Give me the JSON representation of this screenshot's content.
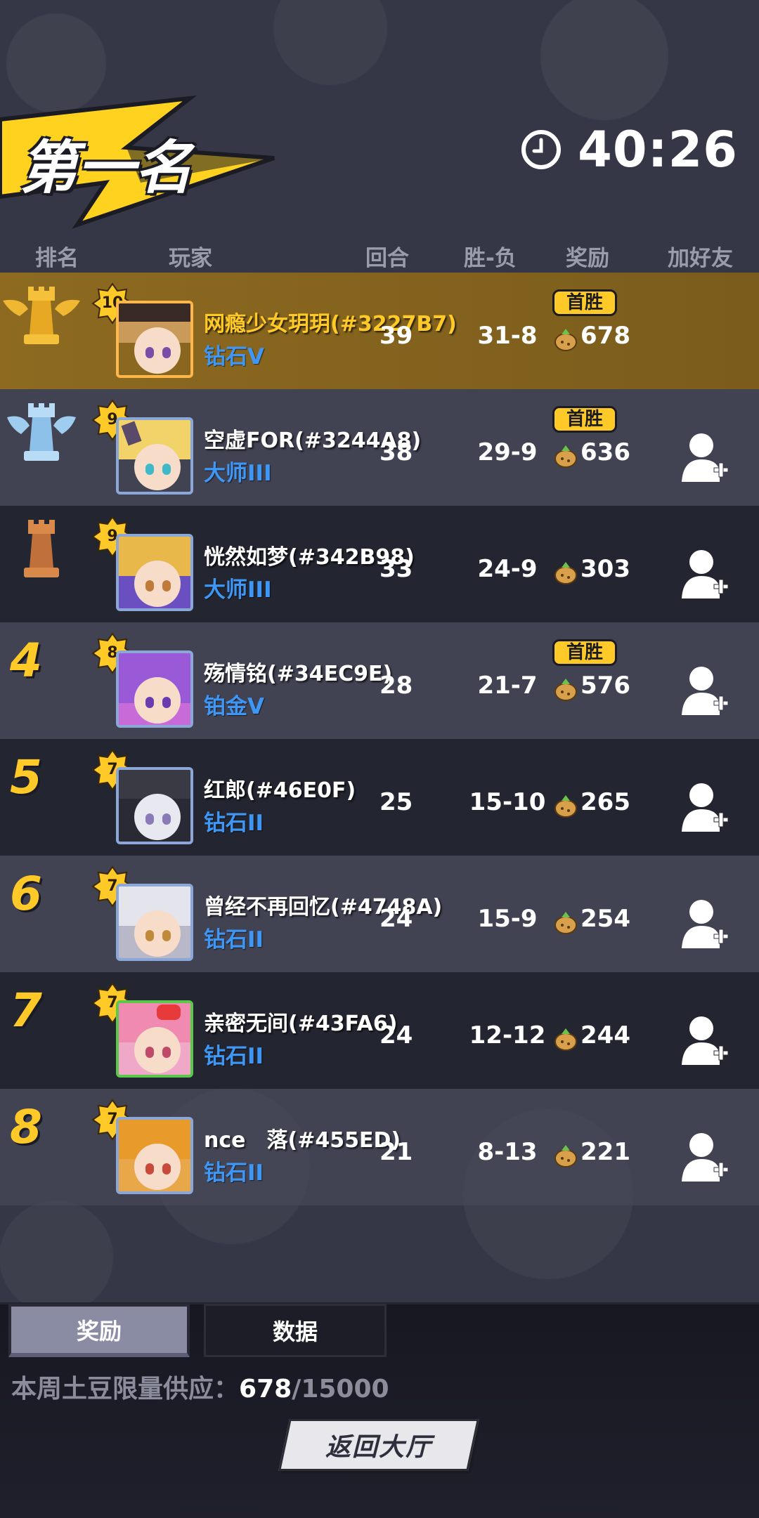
{
  "header": {
    "rank_title": "第一名",
    "timer": "40:26"
  },
  "columns": {
    "rank": "排名",
    "player": "玩家",
    "rounds": "回合",
    "win_loss": "胜-负",
    "reward": "奖励",
    "add_friend": "加好友"
  },
  "first_win_label": "首胜",
  "players": [
    {
      "rank": "1",
      "level": "10",
      "name": "网瘾少女玥玥(#3227B7)",
      "tier": "钻石V",
      "rounds": "39",
      "wl": "31-8",
      "reward": "678"
    },
    {
      "rank": "2",
      "level": "9",
      "name": "空虚FOR(#3244A8)",
      "tier": "大师III",
      "rounds": "38",
      "wl": "29-9",
      "reward": "636"
    },
    {
      "rank": "3",
      "level": "9",
      "name": "恍然如梦(#342B98)",
      "tier": "大师III",
      "rounds": "33",
      "wl": "24-9",
      "reward": "303"
    },
    {
      "rank": "4",
      "level": "8",
      "name": "殇情铭(#34EC9E)",
      "tier": "铂金V",
      "rounds": "28",
      "wl": "21-7",
      "reward": "576"
    },
    {
      "rank": "5",
      "level": "7",
      "name": "红郎(#46E0F)",
      "tier": "钻石II",
      "rounds": "25",
      "wl": "15-10",
      "reward": "265"
    },
    {
      "rank": "6",
      "level": "7",
      "name": "曾经不再回忆(#4748A)",
      "tier": "钻石II",
      "rounds": "24",
      "wl": "15-9",
      "reward": "254"
    },
    {
      "rank": "7",
      "level": "7",
      "name": "亲密无间(#43FA6)",
      "tier": "钻石II",
      "rounds": "24",
      "wl": "12-12",
      "reward": "244"
    },
    {
      "rank": "8",
      "level": "7",
      "name": "nce　落(#455ED)",
      "tier": "钻石II",
      "rounds": "21",
      "wl": "8-13",
      "reward": "221"
    }
  ],
  "tabs": {
    "rewards": "奖励",
    "data": "数据"
  },
  "supply": {
    "label": "本周土豆限量供应：",
    "current": "678",
    "separator": "/",
    "max": "15000"
  },
  "return_button": "返回大厅",
  "colors": {
    "accent_gold": "#ffc928",
    "tier_blue": "#3f97f5",
    "highlight_row": "#8d6a20",
    "background": "#353746"
  },
  "icons": {
    "timer": "clock-icon",
    "reward": "potato-icon",
    "add_friend": "add-friend-icon",
    "rank_1": "gold-rook-icon",
    "rank_2": "silver-rook-icon",
    "rank_3": "bronze-rook-icon"
  }
}
